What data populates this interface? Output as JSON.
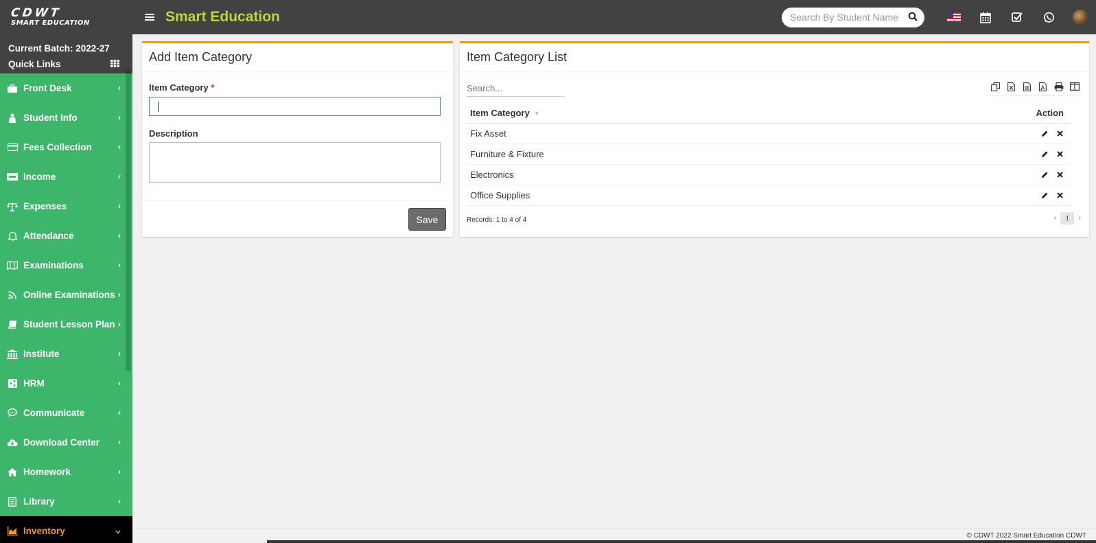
{
  "header": {
    "logo_line1": "CDWT",
    "logo_line2": "SMART EDUCATION",
    "app_title": "Smart Education",
    "search_placeholder": "Search By Student Name",
    "icons": [
      "menu-icon",
      "search-icon",
      "us-flag-icon",
      "calendar-icon",
      "check-square-icon",
      "whatsapp-icon",
      "avatar"
    ]
  },
  "sidebar": {
    "batch_label": "Current Batch: 2022-27",
    "quick_links": "Quick Links",
    "items": [
      {
        "label": "Front Desk",
        "icon": "briefcase-icon"
      },
      {
        "label": "Student Info",
        "icon": "student-icon"
      },
      {
        "label": "Fees Collection",
        "icon": "credit-card-icon"
      },
      {
        "label": "Income",
        "icon": "visa-card-icon"
      },
      {
        "label": "Expenses",
        "icon": "balance-scale-icon"
      },
      {
        "label": "Attendance",
        "icon": "bell-icon"
      },
      {
        "label": "Examinations",
        "icon": "map-icon"
      },
      {
        "label": "Online Examinations",
        "icon": "rss-icon"
      },
      {
        "label": "Student Lesson Plan",
        "icon": "book-icon"
      },
      {
        "label": "Institute",
        "icon": "bank-icon"
      },
      {
        "label": "HRM",
        "icon": "sitemap-icon"
      },
      {
        "label": "Communicate",
        "icon": "chat-icon"
      },
      {
        "label": "Download Center",
        "icon": "cloud-download-icon"
      },
      {
        "label": "Homework",
        "icon": "home-icon"
      },
      {
        "label": "Library",
        "icon": "library-icon"
      },
      {
        "label": "Inventory",
        "icon": "chart-icon",
        "active": true
      }
    ]
  },
  "form": {
    "title": "Add Item Category",
    "category_label": "Item Category",
    "required_mark": "*",
    "category_value": "",
    "description_label": "Description",
    "description_value": "",
    "save_label": "Save"
  },
  "list": {
    "title": "Item Category List",
    "search_placeholder": "Search...",
    "tool_icons": [
      "copy-icon",
      "excel-icon",
      "csv-icon",
      "pdf-icon",
      "print-icon",
      "columns-icon"
    ],
    "columns": [
      "Item Category",
      "Action"
    ],
    "rows": [
      "Fix Asset",
      "Furniture & Fixture",
      "Electronics",
      "Office Supplies"
    ],
    "records_text": "Records: 1 to 4 of 4",
    "current_page": "1",
    "prev": "‹",
    "next": "›"
  },
  "footer": {
    "text": "© CDWT 2022 Smart Education CDWT"
  },
  "colors": {
    "topbar": "#424242",
    "sidebar": "#3db56b",
    "accent_title": "#b9d83e",
    "panel_border": "#f39c12"
  }
}
